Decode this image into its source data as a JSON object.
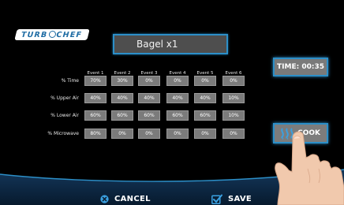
{
  "brand": {
    "logo_text_before": "TURB",
    "logo_text_after": "CHEF"
  },
  "recipe": {
    "name": "Bagel x1"
  },
  "time": {
    "label": "TIME: 00:35"
  },
  "cook": {
    "label": "COOK",
    "icon": "heat-waves-icon"
  },
  "table": {
    "columns": [
      "Event 1",
      "Event 2",
      "Event 3",
      "Event 4",
      "Event 5",
      "Event 6"
    ],
    "rows": [
      {
        "label": "% Time",
        "values": [
          "70%",
          "30%",
          "0%",
          "0%",
          "0%",
          "0%"
        ]
      },
      {
        "label": "% Upper Air",
        "values": [
          "40%",
          "40%",
          "40%",
          "40%",
          "40%",
          "10%"
        ]
      },
      {
        "label": "% Lower Air",
        "values": [
          "60%",
          "60%",
          "60%",
          "60%",
          "60%",
          "10%"
        ]
      },
      {
        "label": "% Microwave",
        "values": [
          "80%",
          "0%",
          "0%",
          "0%",
          "0%",
          "0%"
        ]
      }
    ]
  },
  "footer": {
    "cancel_label": "CANCEL",
    "cancel_icon": "close-circle-icon",
    "save_label": "SAVE",
    "save_icon": "checkbox-icon"
  },
  "colors": {
    "accent": "#2c8fc8",
    "background": "#000000",
    "cell": "#7b7b7b",
    "button": "#7c7c7c",
    "logo_text": "#1d6ba3"
  }
}
